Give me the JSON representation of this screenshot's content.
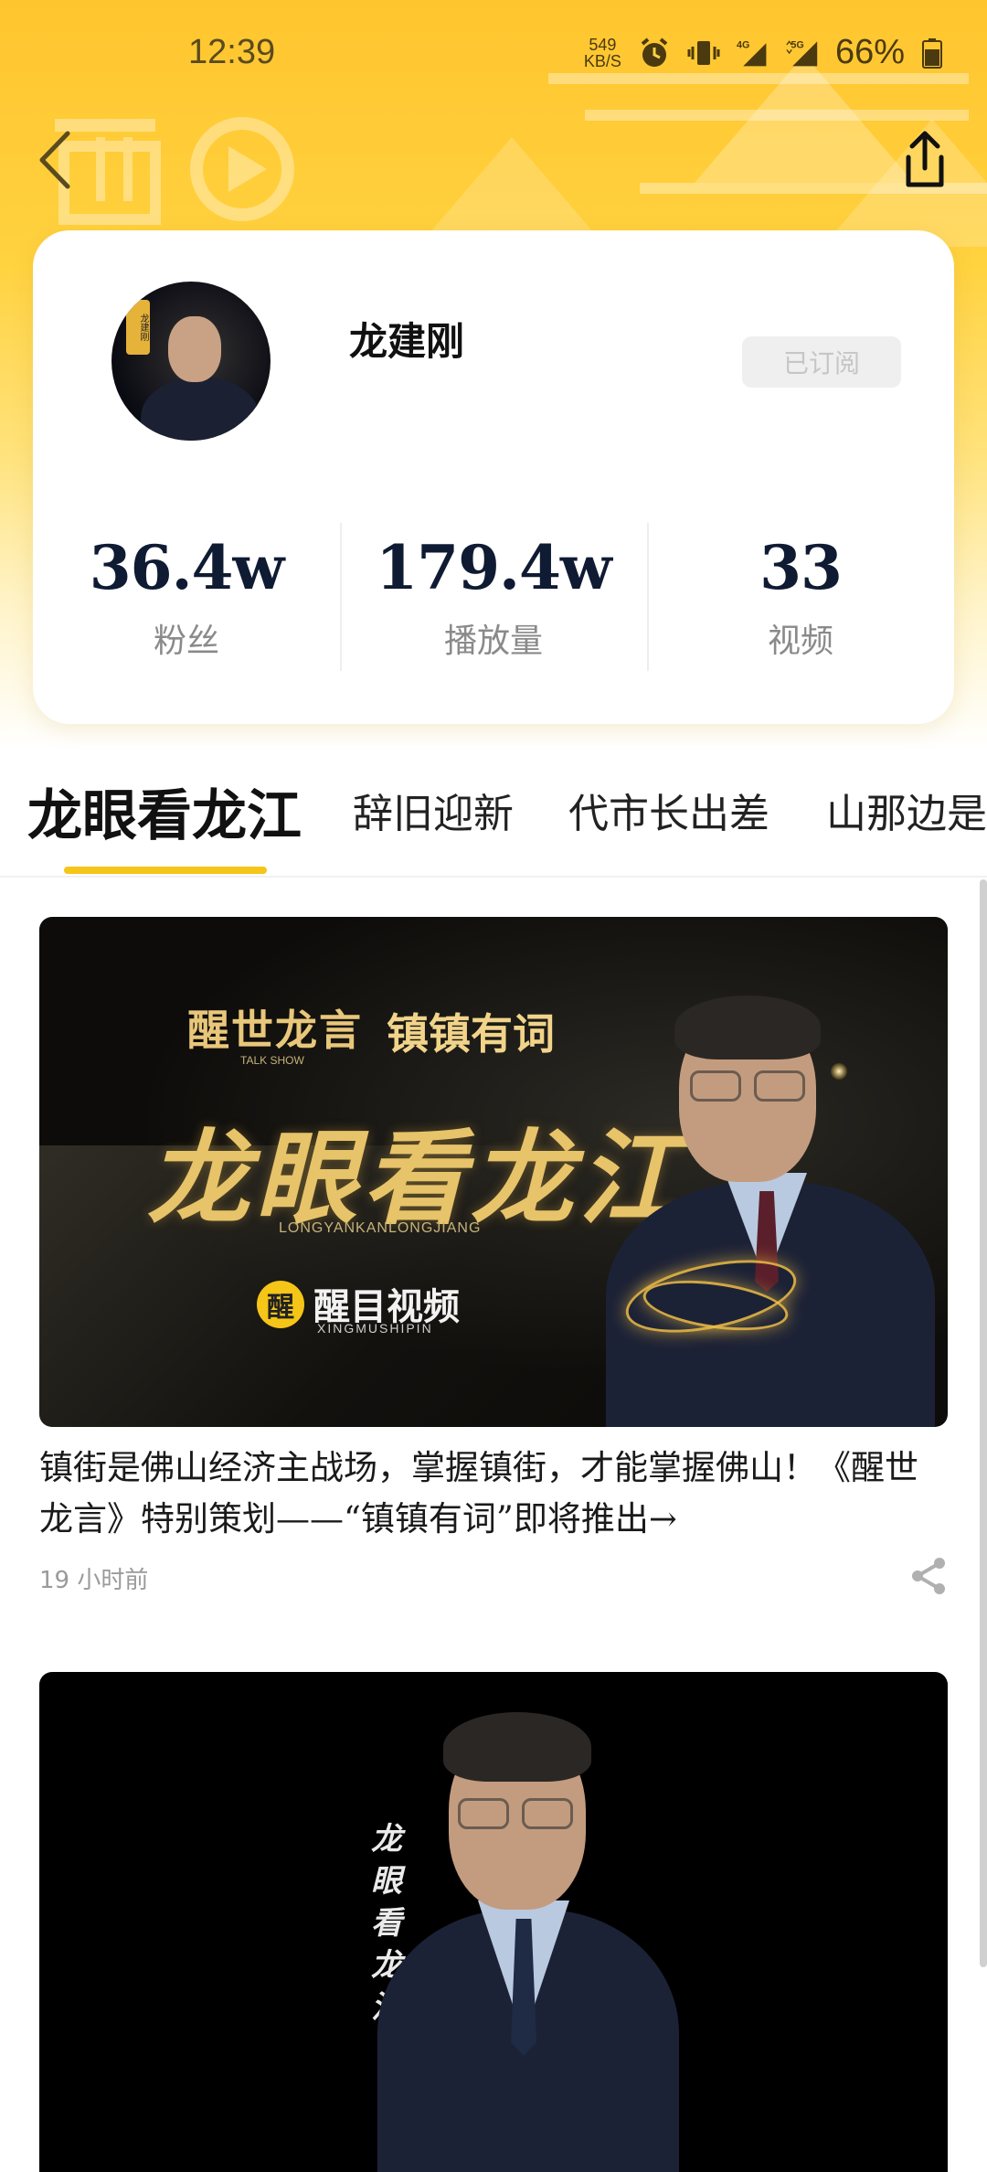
{
  "status_bar": {
    "time": "12:39",
    "net_speed_value": "549",
    "net_speed_unit": "KB/S",
    "signal_4g": "4G",
    "signal_5g": "5G",
    "battery": "66%"
  },
  "profile": {
    "name": "龙建刚",
    "subscribe_label": "已订阅",
    "avatar_tag": "龙建刚",
    "stats": [
      {
        "value": "36.4w",
        "label": "粉丝"
      },
      {
        "value": "179.4w",
        "label": "播放量"
      },
      {
        "value": "33",
        "label": "视频"
      }
    ]
  },
  "tabs": [
    {
      "label": "龙眼看龙江",
      "active": true
    },
    {
      "label": "辞旧迎新",
      "active": false
    },
    {
      "label": "代市长出差",
      "active": false
    },
    {
      "label": "山那边是",
      "active": false
    }
  ],
  "feed": {
    "item1": {
      "thumb": {
        "show_title": "醒世龙言",
        "show_sub": "TALK SHOW",
        "series_title": "镇镇有词",
        "big_title": "龙眼看龙江",
        "big_pinyin": "LONGYANKANLONGJIANG",
        "brand_mark": "醒",
        "brand_name": "醒目视频",
        "brand_pinyin": "XINGMUSHIPIN"
      },
      "caption": "镇街是佛山经济主战场，掌握镇街，才能掌握佛山！《醒世龙言》特别策划——“镇镇有词”即将推出→",
      "time": "19 小时前"
    },
    "item2": {
      "thumb": {
        "vertical_title": "龙眼看龙江"
      }
    }
  },
  "colors": {
    "accent": "#F5C518",
    "header_top": "#FFC52E",
    "stat_value": "#0f1b33"
  }
}
